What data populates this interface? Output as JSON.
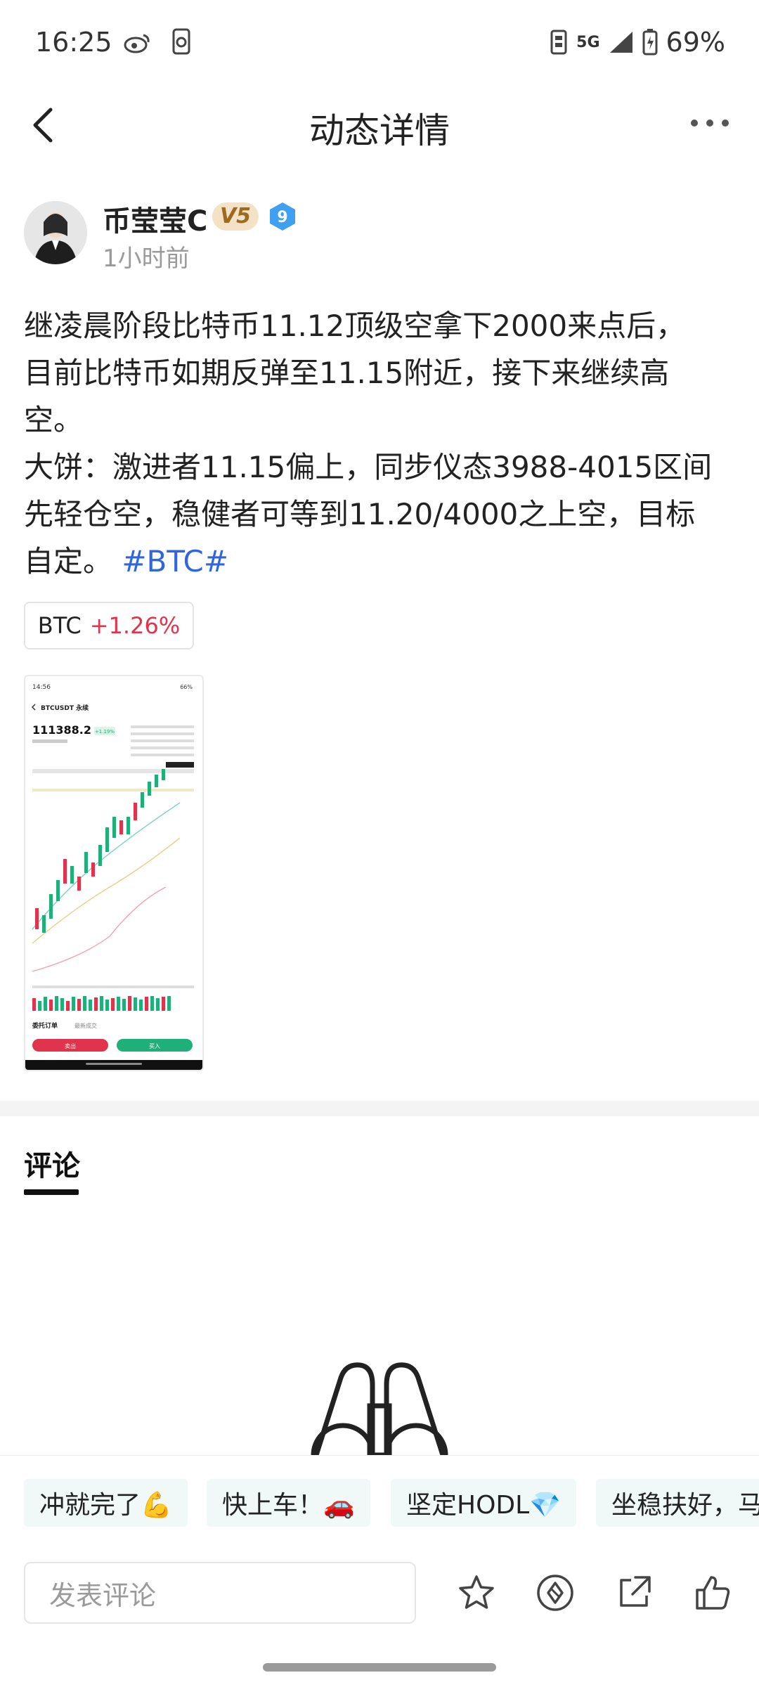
{
  "status_bar": {
    "time": "16:25",
    "network": "5G",
    "battery": "69%"
  },
  "header": {
    "title": "动态详情"
  },
  "author": {
    "name": "币莹莹C",
    "vip_badge": "V5",
    "level": "9",
    "time_ago": "1小时前"
  },
  "post": {
    "text": "继凌晨阶段比特币11.12顶级空拿下2000来点后，\n目前比特币如期反弹至11.15附近，接下来继续高\n空。\n大饼：激进者11.15偏上，同步仪态3988-4015区间\n先轻仓空，稳健者可等到11.20/4000之上空，目标\n自定。 ",
    "hashtag": "#BTC#"
  },
  "ticker": {
    "symbol": "BTC",
    "change": "+1.26%"
  },
  "thumbnail": {
    "time": "14:56",
    "battery": "66%",
    "pair": "BTCUSDT 永续",
    "price": "111388.2",
    "change": "+1.19%",
    "buttons": {
      "sell": "卖出",
      "buy": "买入"
    },
    "tabs": {
      "orders": "委托订单",
      "latest": "最新成交"
    }
  },
  "comments": {
    "tab_label": "评论"
  },
  "quick_replies": [
    "冲就完了💪",
    "快上车！🚗",
    "坚定HODL💎",
    "坐稳扶好，马"
  ],
  "input": {
    "placeholder": "发表评论"
  },
  "icons": [
    "back-icon",
    "more-icon",
    "star-icon",
    "tip-icon",
    "share-icon",
    "like-icon",
    "binoculars-icon"
  ],
  "colors": {
    "hashtag": "#2f66e0",
    "negative": "#e0344c",
    "buy": "#1fb07a",
    "sell": "#e0344c"
  }
}
